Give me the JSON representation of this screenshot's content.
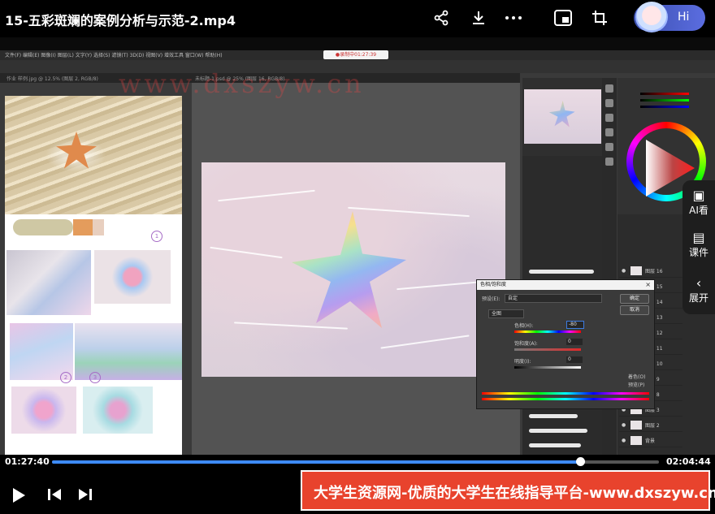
{
  "header": {
    "title": "15-五彩斑斓的案例分析与示范-2.mp4",
    "hi_label": "Hi",
    "icons": [
      "share-icon",
      "download-icon",
      "more-icon",
      "picture-in-picture-icon",
      "crop-icon"
    ]
  },
  "photoshop": {
    "menu": "文件(F)  编辑(E)  图像(I)  图层(L)  文字(Y)  选择(S)  滤镜(T)  3D(D)  视图(V)  增效工具  窗口(W)  帮助(H)",
    "rec_badge": "●录制中01:27:39",
    "doc_tab_1": "作业 样例.jpg @ 12.5% (图层 2, RGB/8)",
    "doc_tab_2": "未标题-1.psd @ 25% (图层 16, RGB/8)",
    "dialog": {
      "title": "色相/饱和度",
      "preset_label": "预设(E):",
      "preset_value": "自定",
      "channel_value": "全图",
      "hue_label": "色相(H):",
      "hue_value": "-80",
      "saturation_label": "饱和度(A):",
      "saturation_value": "0",
      "lightness_label": "明度(I):",
      "lightness_value": "0",
      "ok_label": "确定",
      "cancel_label": "取消",
      "colorize_label": "着色(O)",
      "preview_label": "预览(P)"
    },
    "layers": [
      {
        "name": "图层 16"
      },
      {
        "name": "图层 15"
      },
      {
        "name": "图层 14"
      },
      {
        "name": "图层 13"
      },
      {
        "name": "图层 12"
      },
      {
        "name": "图层 11"
      },
      {
        "name": "图层 10"
      },
      {
        "name": "图层 9"
      },
      {
        "name": "图层 8"
      },
      {
        "name": "图层 3"
      },
      {
        "name": "图层 2"
      },
      {
        "name": "背景"
      }
    ]
  },
  "reference": {
    "circle_1": "1",
    "circle_2": "2",
    "circle_3": "3"
  },
  "watermark": "www.dxszyw.cn",
  "side_panel": {
    "ai_label": "AI看",
    "courseware_label": "课件",
    "expand_label": "展开"
  },
  "player": {
    "current_time": "01:27:40",
    "total_time": "02:04:44",
    "progress_fraction": 0.87
  },
  "ad_banner": "大学生资源网-优质的大学生在线指导平台-www.dxszyw.cn"
}
